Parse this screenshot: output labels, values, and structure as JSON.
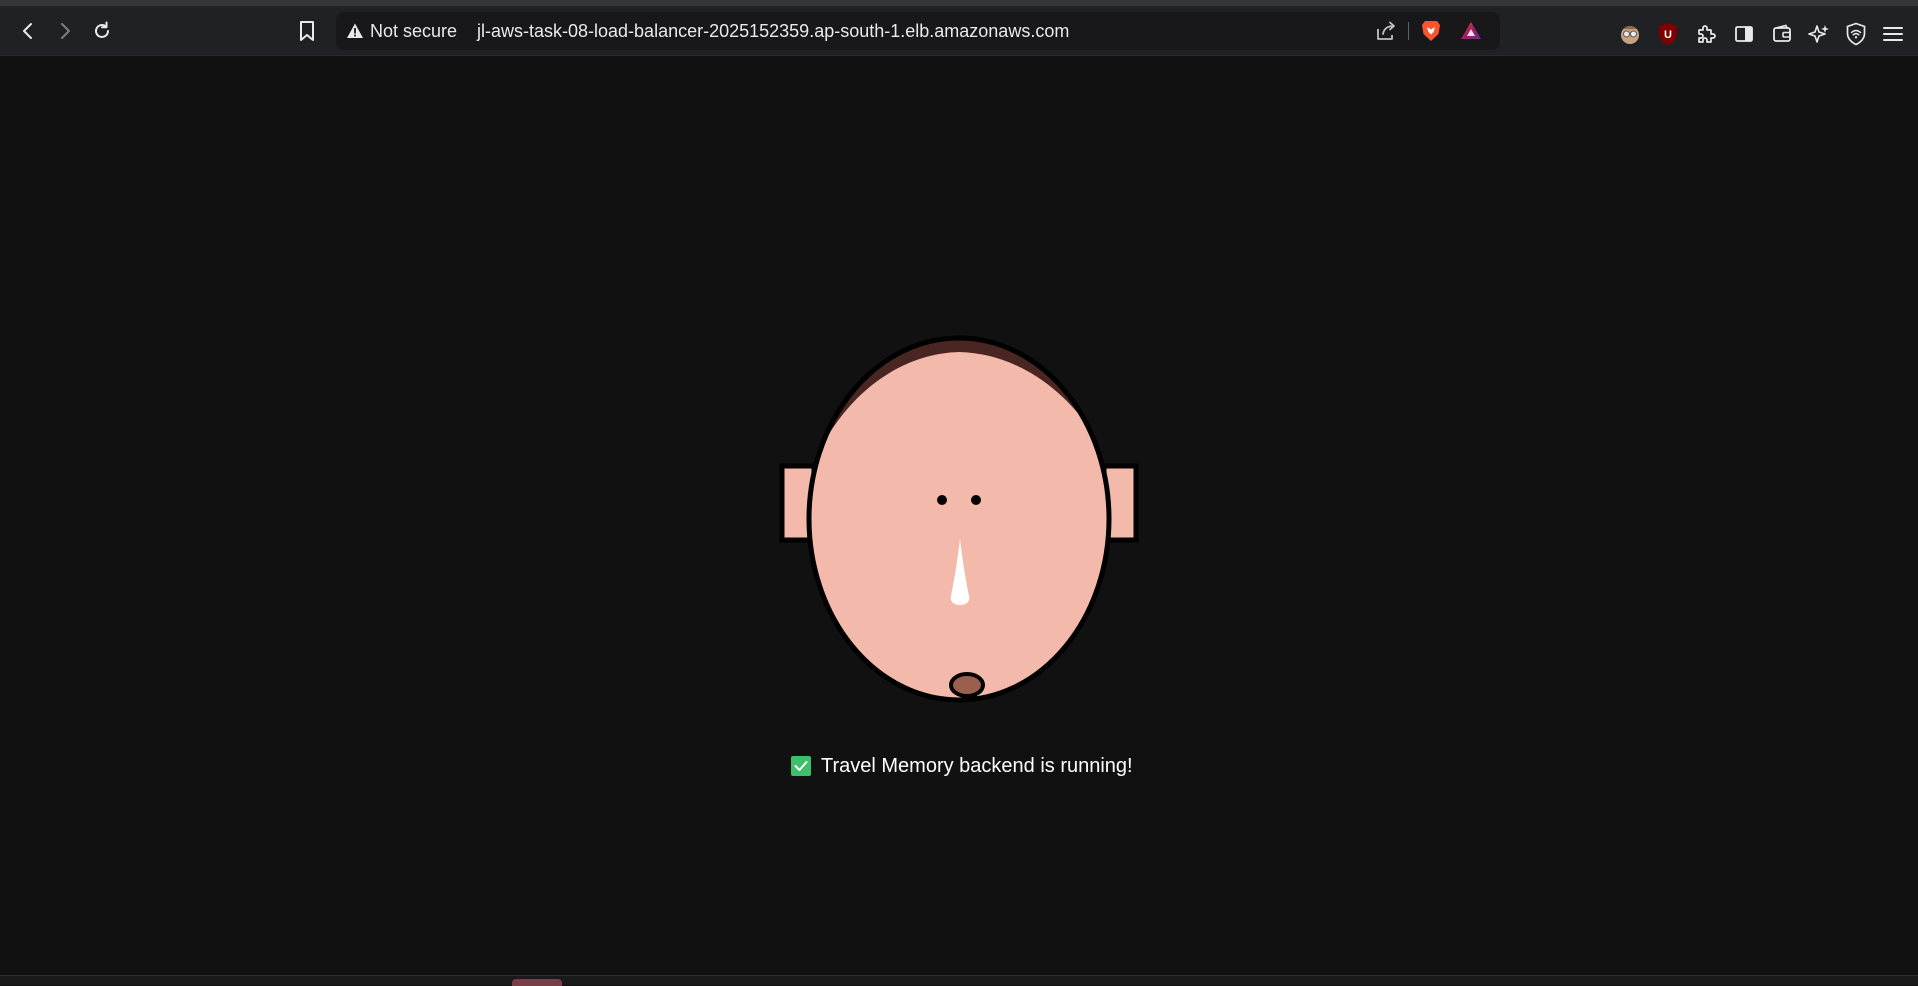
{
  "browser": {
    "security_label": "Not secure",
    "url": "jl-aws-task-08-load-balancer-2025152359.ap-south-1.elb.amazonaws.com",
    "icons": [
      "back-icon",
      "forward-icon",
      "reload-icon",
      "bookmark-icon",
      "warning-icon",
      "share-icon",
      "brave-shields-icon",
      "brave-rewards-icon",
      "extension-avatar-icon",
      "ublock-icon",
      "extensions-icon",
      "sidebar-icon",
      "wallet-icon",
      "leo-ai-icon",
      "vpn-icon",
      "menu-icon"
    ]
  },
  "page": {
    "status_text": "Travel Memory backend is running!",
    "status_icon": "checkbox-checked-icon",
    "colors": {
      "background": "#111111",
      "skin": "#f3b9aa",
      "hair": "#4a2622",
      "mouth": "#9b5f4f",
      "check": "#3dbf6b"
    }
  }
}
